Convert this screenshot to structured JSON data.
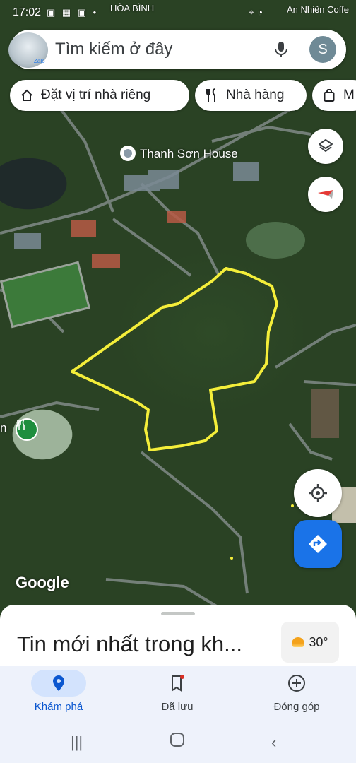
{
  "status_bar": {
    "time": "17:02",
    "place_left": "HÒA BÌNH",
    "place_right": "An Nhiên Coffe"
  },
  "search": {
    "placeholder": "Tìm kiếm ở đây",
    "profile_initial": "S",
    "avatar_badge": "Zalo"
  },
  "chips": [
    {
      "label": "Đặt vị trí nhà riêng",
      "icon": "home-icon"
    },
    {
      "label": "Nhà hàng",
      "icon": "restaurant-icon"
    },
    {
      "label": "M",
      "icon": "shopping-bag-icon"
    }
  ],
  "map": {
    "poi_label": "Thanh Sơn House",
    "restaurant_label": "n",
    "attribution": "Google",
    "outline_color": "#f4ee3a"
  },
  "sheet": {
    "headline": "Tin mới nhất trong kh...",
    "weather": "30°"
  },
  "nav": {
    "items": [
      {
        "label": "Khám phá",
        "icon": "explore-pin-icon",
        "active": true
      },
      {
        "label": "Đã lưu",
        "icon": "bookmark-icon",
        "active": false
      },
      {
        "label": "Đóng góp",
        "icon": "add-circle-icon",
        "active": false
      }
    ]
  },
  "colors": {
    "accent": "#1a73e8",
    "active_nav": "#0b57d0",
    "nav_bg": "#eef2fb"
  }
}
